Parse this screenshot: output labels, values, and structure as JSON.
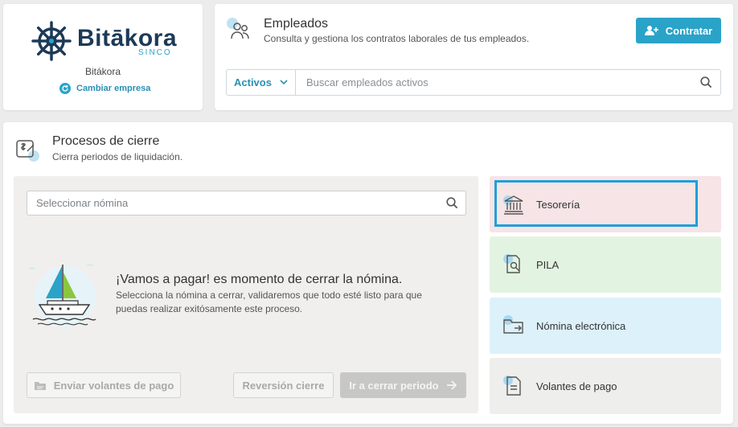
{
  "company": {
    "logo_text": "Bitākora",
    "logo_subtext": "SINCO",
    "name": "Bitákora",
    "change_label": "Cambiar empresa"
  },
  "employees": {
    "title": "Empleados",
    "subtitle": "Consulta y gestiona los contratos laborales de tus empleados.",
    "hire_button": "Contratar",
    "status_value": "Activos",
    "search_placeholder": "Buscar empleados activos"
  },
  "closing": {
    "title": "Procesos de cierre",
    "subtitle": "Cierra periodos de liquidación.",
    "payroll_placeholder": "Seleccionar nómina",
    "message_title": "¡Vamos a pagar! es momento de cerrar la nómina.",
    "message_body": "Selecciona la nómina a cerrar, validaremos que todo esté listo para que puedas realizar exitósamente este proceso.",
    "buttons": {
      "send": "Enviar volantes de pago",
      "revert": "Reversión cierre",
      "close_period": "Ir a cerrar periodo"
    },
    "shortcuts": [
      {
        "label": "Tesorería",
        "icon": "bank-icon"
      },
      {
        "label": "PILA",
        "icon": "document-search-icon"
      },
      {
        "label": "Nómina electrónica",
        "icon": "folder-arrow-icon"
      },
      {
        "label": "Volantes de pago",
        "icon": "document-icon"
      }
    ]
  },
  "colors": {
    "accent": "#2aa3c9",
    "brand_dark": "#1d3a57",
    "tesoreria_bg": "#f6e4e6",
    "pila_bg": "#e3f3e1",
    "nomina_bg": "#ddf1fb",
    "volantes_bg": "#eeeeed",
    "focus": "#1f9fda"
  }
}
